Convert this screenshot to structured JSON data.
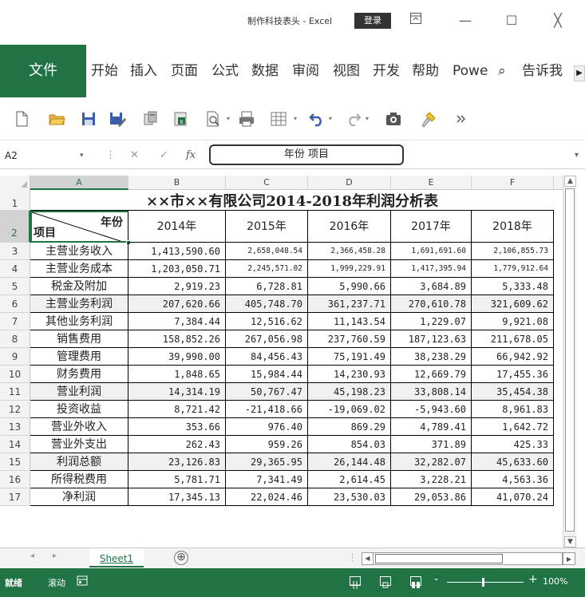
{
  "titlebar": {
    "title": "制作科技表头 - Excel",
    "login": "登录",
    "ribbon_display_icon": "ribbon-display-icon",
    "minimize": "—",
    "maximize": "☐",
    "close": "╳"
  },
  "ribbon": {
    "file": "文件",
    "tabs": [
      "开始",
      "插入",
      "页面",
      "公式",
      "数据",
      "审阅",
      "视图",
      "开发",
      "帮助",
      "Powe",
      "告诉我"
    ],
    "search_icon": "⌕",
    "scroll_right": "▶"
  },
  "toolbar": {
    "icons": [
      "new-document-icon",
      "open-folder-icon",
      "save-icon",
      "save-as-icon",
      "copy-icon",
      "paste-special-icon",
      "print-preview-icon",
      "print-icon",
      "table-icon",
      "undo-icon",
      "redo-icon",
      "camera-icon",
      "format-painter-icon",
      "more-icon"
    ]
  },
  "formula_bar": {
    "name_box": "A2",
    "cancel": "✕",
    "enter": "✓",
    "fx": "fx",
    "content": "年份         项目",
    "colon": "⋮"
  },
  "grid": {
    "columns": [
      "A",
      "B",
      "C",
      "D",
      "E",
      "F"
    ],
    "rows": [
      "1",
      "2",
      "3",
      "4",
      "5",
      "6",
      "7",
      "8",
      "9",
      "10",
      "11",
      "12",
      "13",
      "14",
      "15",
      "16",
      "17"
    ],
    "title": "××市××有限公司2014-2018年利润分析表",
    "header_year": "年份",
    "header_item": "项目",
    "years": [
      "2014年",
      "2015年",
      "2016年",
      "2017年",
      "2018年"
    ],
    "data": [
      {
        "label": "主营业务收入",
        "values": [
          "1,413,590.60",
          "2,658,048.54",
          "2,366,458.28",
          "1,691,691.60",
          "2,106,855.73"
        ]
      },
      {
        "label": "主营业务成本",
        "values": [
          "1,203,050.71",
          "2,245,571.02",
          "1,999,229.91",
          "1,417,395.94",
          "1,779,912.64"
        ]
      },
      {
        "label": "税金及附加",
        "values": [
          "2,919.23",
          "6,728.81",
          "5,990.66",
          "3,684.89",
          "5,333.48"
        ]
      },
      {
        "label": "主营业务利润",
        "values": [
          "207,620.66",
          "405,748.70",
          "361,237.71",
          "270,610.78",
          "321,609.62"
        ]
      },
      {
        "label": "其他业务利润",
        "values": [
          "7,384.44",
          "12,516.62",
          "11,143.54",
          "1,229.07",
          "9,921.08"
        ]
      },
      {
        "label": "销售费用",
        "values": [
          "158,852.26",
          "267,056.98",
          "237,760.59",
          "187,123.63",
          "211,678.05"
        ]
      },
      {
        "label": "管理费用",
        "values": [
          "39,990.00",
          "84,456.43",
          "75,191.49",
          "38,238.29",
          "66,942.92"
        ]
      },
      {
        "label": "财务费用",
        "values": [
          "1,848.65",
          "15,984.44",
          "14,230.93",
          "12,669.79",
          "17,455.36"
        ]
      },
      {
        "label": "营业利润",
        "values": [
          "14,314.19",
          "50,767.47",
          "45,198.23",
          "33,808.14",
          "35,454.38"
        ]
      },
      {
        "label": "投资收益",
        "values": [
          "8,721.42",
          "-21,418.66",
          "-19,069.02",
          "-5,943.60",
          "8,961.83"
        ]
      },
      {
        "label": "营业外收入",
        "values": [
          "353.66",
          "976.40",
          "869.29",
          "4,789.41",
          "1,642.72"
        ]
      },
      {
        "label": "营业外支出",
        "values": [
          "262.43",
          "959.26",
          "854.03",
          "371.89",
          "425.33"
        ]
      },
      {
        "label": "利润总额",
        "values": [
          "23,126.83",
          "29,365.95",
          "26,144.48",
          "32,282.07",
          "45,633.60"
        ]
      },
      {
        "label": "所得税费用",
        "values": [
          "5,781.71",
          "7,341.49",
          "2,614.45",
          "3,228.21",
          "4,563.36"
        ]
      },
      {
        "label": "净利润",
        "values": [
          "17,345.13",
          "22,024.46",
          "23,530.03",
          "29,053.86",
          "41,070.24"
        ]
      }
    ]
  },
  "sheets": {
    "active": "Sheet1",
    "add": "⊕"
  },
  "statusbar": {
    "ready": "就绪",
    "scroll": "滚动",
    "zoom_minus": "-",
    "zoom_plus": "+",
    "zoom": "100%"
  },
  "colors": {
    "accent": "#217346",
    "shade": "#f0f0f0"
  }
}
